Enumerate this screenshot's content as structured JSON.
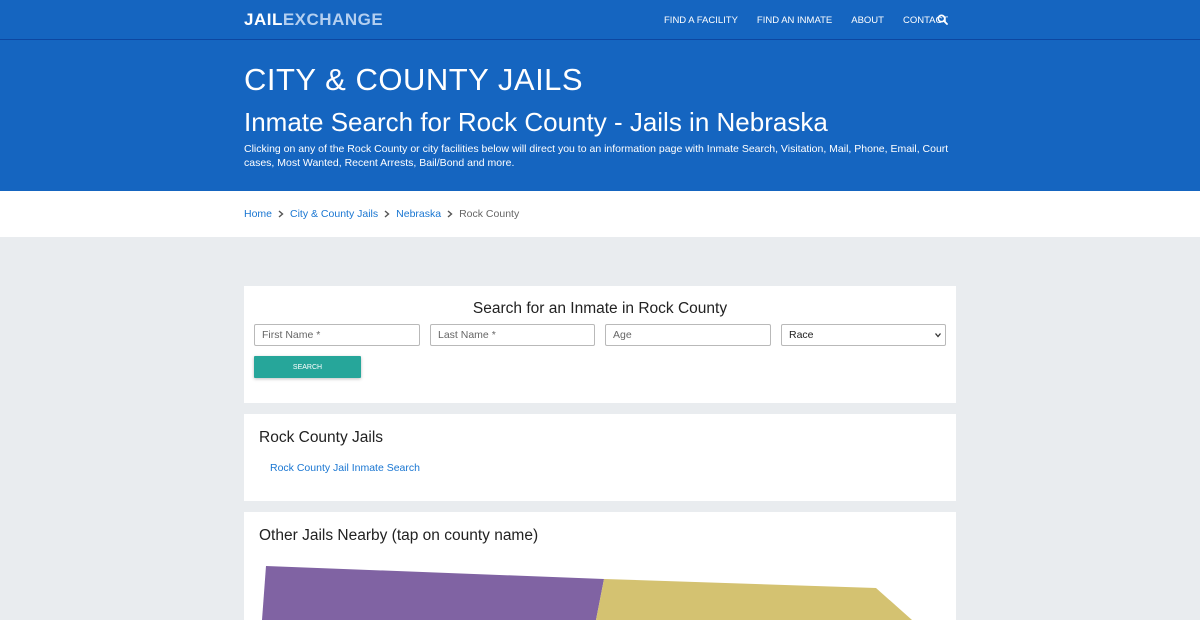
{
  "brand": {
    "part1": "JAIL",
    "part2": "EXCHANGE"
  },
  "nav": {
    "items": [
      {
        "label": "FIND A FACILITY"
      },
      {
        "label": "FIND AN INMATE"
      },
      {
        "label": "ABOUT"
      },
      {
        "label": "CONTACT"
      }
    ],
    "search_icon": "search-icon"
  },
  "hero": {
    "kicker": "CITY & COUNTY JAILS",
    "title": "Inmate Search for Rock County - Jails in Nebraska",
    "description": "Clicking on any of the Rock County or city facilities below will direct you to an information page with Inmate Search, Visitation, Mail, Phone, Email, Court cases, Most Wanted, Recent Arrests, Bail/Bond and more."
  },
  "breadcrumb": {
    "items": [
      {
        "label": "Home"
      },
      {
        "label": "City & County Jails"
      },
      {
        "label": "Nebraska"
      }
    ],
    "current": "Rock County"
  },
  "search_form": {
    "title": "Search for an Inmate in Rock County",
    "first_name_placeholder": "First Name *",
    "last_name_placeholder": "Last Name *",
    "age_placeholder": "Age",
    "race_selected": "Race",
    "button_label": "SEARCH"
  },
  "jails_section": {
    "heading": "Rock County Jails",
    "links": [
      {
        "label": "Rock County Jail Inmate Search"
      }
    ]
  },
  "nearby_section": {
    "heading": "Other Jails Nearby (tap on county name)",
    "map_colors": {
      "purple": "#8063a3",
      "yellow": "#d4c271"
    }
  },
  "colors": {
    "primary": "#1565c0",
    "accent": "#26a69a",
    "link": "#1976d2"
  }
}
